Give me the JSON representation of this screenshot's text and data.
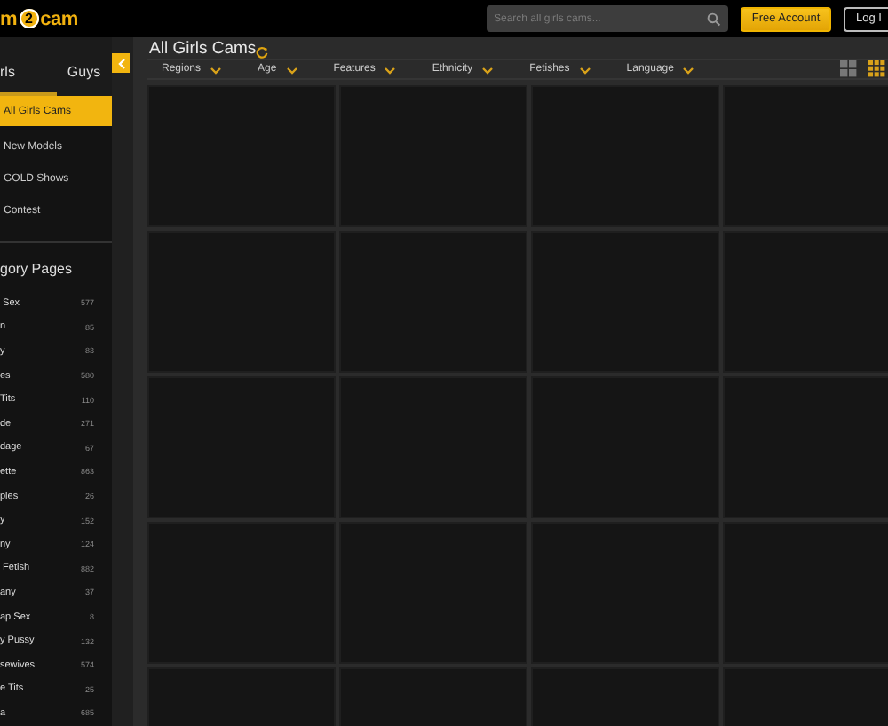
{
  "header": {
    "logo": {
      "left": "m",
      "mark": "2",
      "right": "cam"
    },
    "search": {
      "placeholder": "Search all girls cams..."
    },
    "buttons": [
      {
        "label": "Free Account",
        "kind": "primary"
      },
      {
        "label": "Log I",
        "kind": "outline"
      }
    ]
  },
  "sidebar": {
    "tabs": [
      {
        "label": "rls",
        "selected": true
      },
      {
        "label": "Guys",
        "selected": false
      }
    ],
    "menu": [
      {
        "label": "All Girls Cams",
        "selected": true
      },
      {
        "label": "New Models",
        "selected": false
      },
      {
        "label": "GOLD Shows",
        "selected": false
      },
      {
        "label": "Contest",
        "selected": false
      }
    ],
    "section_title": "gory Pages",
    "categories": [
      {
        "label": " Sex",
        "count": "577"
      },
      {
        "label": "n",
        "count": "85"
      },
      {
        "label": "y",
        "count": "83"
      },
      {
        "label": "es",
        "count": "580"
      },
      {
        "label": "Tits",
        "count": "110"
      },
      {
        "label": "de",
        "count": "271"
      },
      {
        "label": "dage",
        "count": "67"
      },
      {
        "label": "ette",
        "count": "863"
      },
      {
        "label": "ples",
        "count": "26"
      },
      {
        "label": "y",
        "count": "152"
      },
      {
        "label": "ny",
        "count": "124"
      },
      {
        "label": " Fetish",
        "count": "882"
      },
      {
        "label": "any",
        "count": "37"
      },
      {
        "label": "ap Sex",
        "count": "8"
      },
      {
        "label": "y Pussy",
        "count": "132"
      },
      {
        "label": "sewives",
        "count": "574"
      },
      {
        "label": "e Tits",
        "count": "25"
      },
      {
        "label": "a",
        "count": "685"
      }
    ]
  },
  "main": {
    "title": "All Girls Cams",
    "filters": [
      "Regions",
      "Age",
      "Features",
      "Ethnicity",
      "Fetishes",
      "Language"
    ],
    "views": [
      {
        "kind": "large",
        "selected": false
      },
      {
        "kind": "small",
        "selected": true
      }
    ],
    "tiles": [
      {
        "kind": "empty"
      },
      {
        "kind": "empty"
      },
      {
        "kind": "empty"
      },
      {
        "kind": "empty"
      },
      {
        "kind": "empty"
      },
      {
        "kind": "empty"
      },
      {
        "kind": "empty"
      },
      {
        "kind": "empty"
      },
      {
        "kind": "empty"
      },
      {
        "kind": "empty"
      },
      {
        "kind": "empty"
      },
      {
        "kind": "empty"
      },
      {
        "kind": "empty"
      },
      {
        "kind": "empty"
      },
      {
        "kind": "empty"
      },
      {
        "kind": "empty"
      },
      {
        "kind": "empty"
      },
      {
        "kind": "empty"
      },
      {
        "kind": "empty"
      },
      {
        "kind": "empty"
      }
    ]
  }
}
